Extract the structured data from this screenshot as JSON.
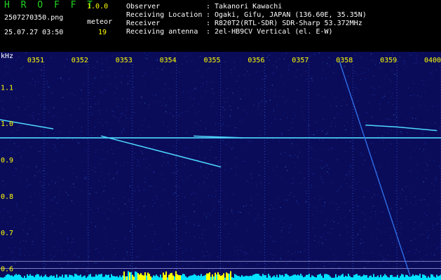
{
  "header": {
    "logo": "H R O F F T",
    "version": "1.0.0",
    "filename": "2507270350.png",
    "datetime": "25.07.27 03:50",
    "meteor_label": "meteor",
    "meteor_count": "19",
    "info": [
      {
        "key": "Observer",
        "value": "Takanori Kawachi"
      },
      {
        "key": "Receiving Location",
        "value": "Ogaki, Gifu, JAPAN (136.60E, 35.35N)"
      },
      {
        "key": "Receiver",
        "value": "R820T2(RTL-SDR) SDR-Sharp 53.372MHz"
      },
      {
        "key": "Receiving antenna",
        "value": "2el-HB9CV Vertical (el. E-W)"
      }
    ],
    "separator": ":"
  },
  "colors": {
    "background": "#0a0c5a",
    "trace": "#4fd8ff",
    "time_label": "#ffff00",
    "freq_label": "#ffff00",
    "noise_bar": "#00e0ff",
    "noise_peak": "#ffff00"
  },
  "chart_data": {
    "type": "heatmap",
    "yunit_label": "kHz",
    "x_ticks": [
      "0351",
      "0352",
      "0353",
      "0354",
      "0355",
      "0356",
      "0357",
      "0358",
      "0359",
      "0400"
    ],
    "x_range": [
      "0350",
      "0400"
    ],
    "y_ticks": [
      "1.1",
      "1.0",
      "0.9",
      "0.8",
      "0.7",
      "0.6"
    ],
    "y_range": [
      0.58,
      1.17
    ],
    "carrier_freq": 0.96,
    "meteor_traces": [
      {
        "t_start": 0.0,
        "f_start": 1.01,
        "t_end": 1.2,
        "f_end": 0.985
      },
      {
        "t_start": 2.3,
        "f_start": 0.965,
        "t_end": 5.0,
        "f_end": 0.88
      },
      {
        "t_start": 4.4,
        "f_start": 0.965,
        "t_end": 5.5,
        "f_end": 0.96
      },
      {
        "t_start": 8.3,
        "f_start": 0.995,
        "t_end": 9.0,
        "f_end": 0.99
      },
      {
        "t_start": 9.0,
        "f_start": 0.99,
        "t_end": 9.9,
        "f_end": 0.98
      }
    ],
    "interference_sweep": {
      "t_start": 7.7,
      "f_start": 1.17,
      "t_end": 9.3,
      "f_end": 0.58
    }
  }
}
